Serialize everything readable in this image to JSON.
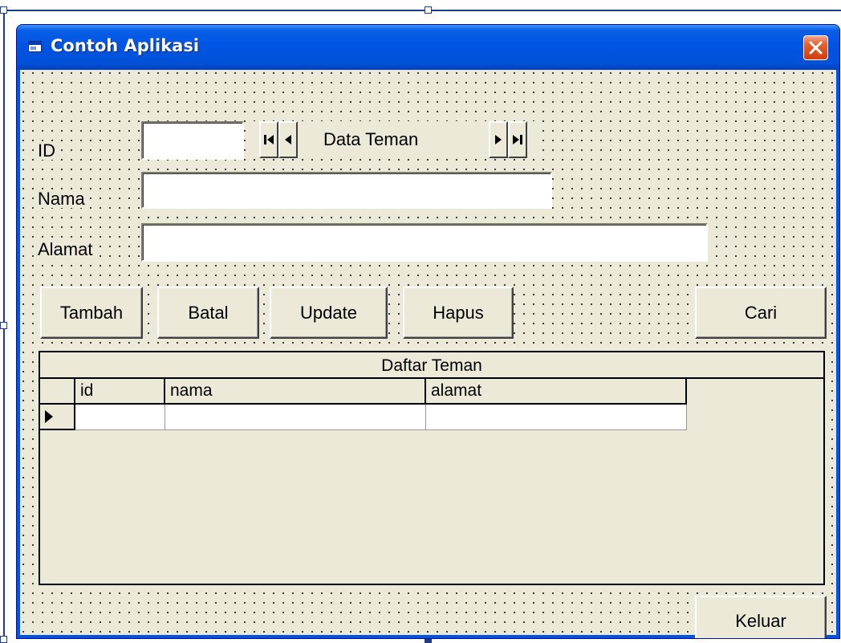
{
  "window": {
    "title": "Contoh Aplikasi"
  },
  "form": {
    "id_label": "ID",
    "nama_label": "Nama",
    "alamat_label": "Alamat",
    "id_value": "",
    "nama_value": "",
    "alamat_value": ""
  },
  "data_control": {
    "caption": "Data Teman"
  },
  "buttons": {
    "tambah": "Tambah",
    "batal": "Batal",
    "update": "Update",
    "hapus": "Hapus",
    "cari": "Cari",
    "keluar": "Keluar"
  },
  "grid": {
    "caption": "Daftar Teman",
    "columns": [
      "id",
      "nama",
      "alamat"
    ],
    "rows": [
      [
        "",
        "",
        ""
      ]
    ],
    "current_row_marker": "▶"
  },
  "icons": {
    "app": "app-form-icon",
    "close": "close-icon",
    "first": "first-record-icon",
    "prev": "previous-record-icon",
    "next": "next-record-icon",
    "last": "last-record-icon"
  },
  "colors": {
    "titlebar": "#0054e3",
    "client": "#ece9d8",
    "close": "#e3612d",
    "selection_handle": "#1e3a8a"
  }
}
